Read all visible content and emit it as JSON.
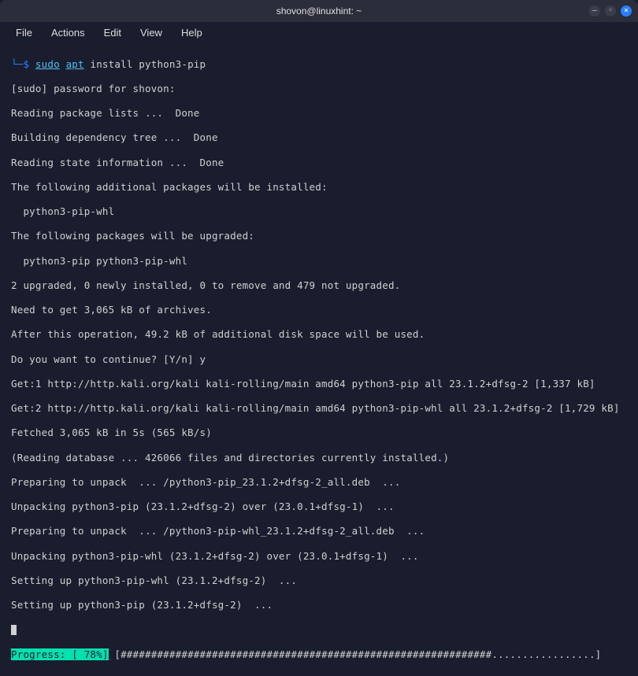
{
  "window": {
    "title": "shovon@linuxhint: ~"
  },
  "menubar": {
    "items": [
      "File",
      "Actions",
      "Edit",
      "View",
      "Help"
    ]
  },
  "prompt": {
    "head": "└─",
    "dollar": "$",
    "sudo": "sudo",
    "apt": "apt",
    "rest": " install python3-pip"
  },
  "output": {
    "lines": [
      "[sudo] password for shovon:",
      "Reading package lists ...  Done",
      "Building dependency tree ...  Done",
      "Reading state information ...  Done",
      "The following additional packages will be installed:",
      "  python3-pip-whl",
      "The following packages will be upgraded:",
      "  python3-pip python3-pip-whl",
      "2 upgraded, 0 newly installed, 0 to remove and 479 not upgraded.",
      "Need to get 3,065 kB of archives.",
      "After this operation, 49.2 kB of additional disk space will be used.",
      "Do you want to continue? [Y/n] y",
      "Get:1 http://http.kali.org/kali kali-rolling/main amd64 python3-pip all 23.1.2+dfsg-2 [1,337 kB]",
      "Get:2 http://http.kali.org/kali kali-rolling/main amd64 python3-pip-whl all 23.1.2+dfsg-2 [1,729 kB]",
      "Fetched 3,065 kB in 5s (565 kB/s)",
      "(Reading database ... 426066 files and directories currently installed.)",
      "Preparing to unpack  ... /python3-pip_23.1.2+dfsg-2_all.deb  ...",
      "Unpacking python3-pip (23.1.2+dfsg-2) over (23.0.1+dfsg-1)  ...",
      "Preparing to unpack  ... /python3-pip-whl_23.1.2+dfsg-2_all.deb  ...",
      "Unpacking python3-pip-whl (23.1.2+dfsg-2) over (23.0.1+dfsg-1)  ...",
      "Setting up python3-pip-whl (23.1.2+dfsg-2)  ...",
      "Setting up python3-pip (23.1.2+dfsg-2)  ..."
    ]
  },
  "progress": {
    "label": "Progress: [ 78%]",
    "bar": " [#############################################################.................]"
  }
}
